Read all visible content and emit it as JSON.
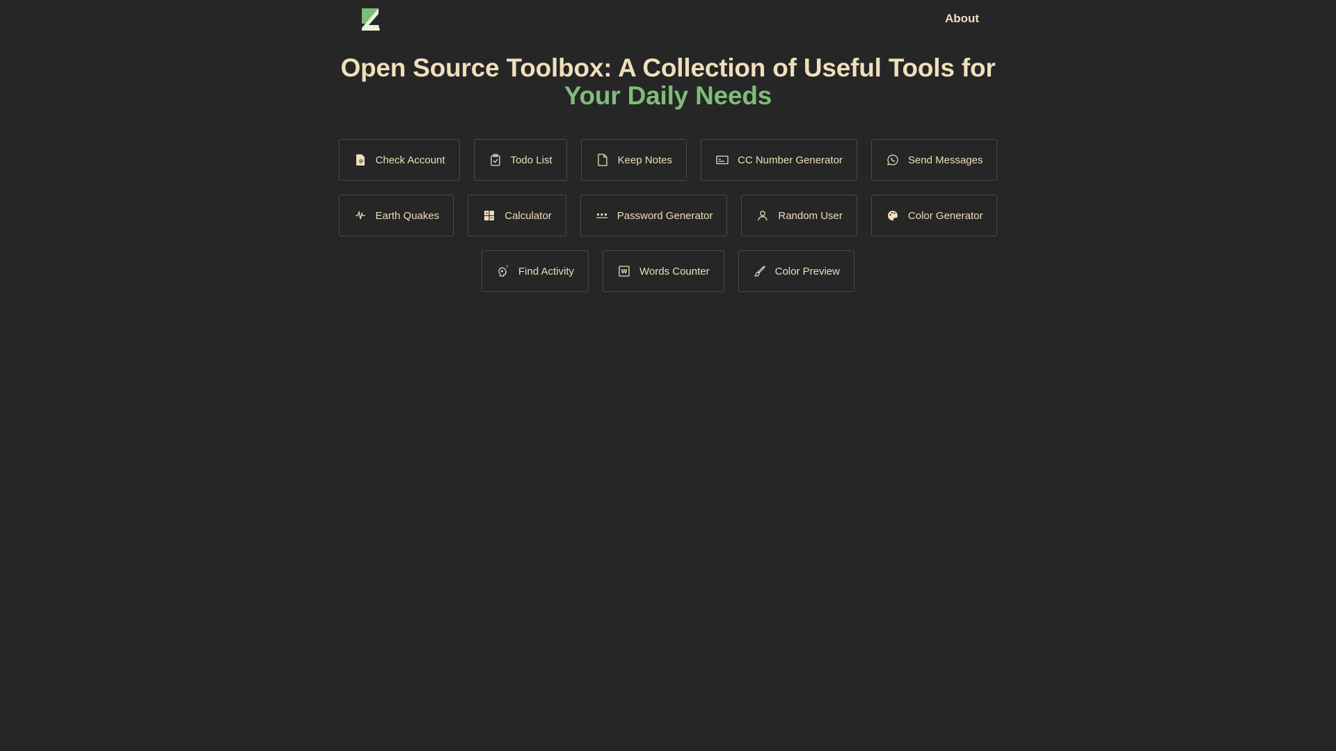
{
  "header": {
    "logo_icon": "z-logo-icon",
    "about_label": "About"
  },
  "hero": {
    "title_main": "Open Source Toolbox: A Collection of Useful Tools for",
    "title_accent": "Your Daily Needs"
  },
  "colors": {
    "background": "#262626",
    "text": "#efdfbb",
    "accent": "#7fbd7a",
    "border": "#4a4a4a"
  },
  "tools": {
    "row1": [
      {
        "label": "Check Account",
        "icon": "account-search-icon"
      },
      {
        "label": "Todo List",
        "icon": "clipboard-check-icon"
      },
      {
        "label": "Keep Notes",
        "icon": "note-icon"
      },
      {
        "label": "CC Number Generator",
        "icon": "credit-card-icon"
      },
      {
        "label": "Send Messages",
        "icon": "whatsapp-icon"
      }
    ],
    "row2": [
      {
        "label": "Earth Quakes",
        "icon": "seismic-icon"
      },
      {
        "label": "Calculator",
        "icon": "calculator-icon"
      },
      {
        "label": "Password Generator",
        "icon": "password-dots-icon"
      },
      {
        "label": "Random User",
        "icon": "user-icon"
      },
      {
        "label": "Color Generator",
        "icon": "palette-icon"
      }
    ],
    "row3": [
      {
        "label": "Find Activity",
        "icon": "thinking-head-icon"
      },
      {
        "label": "Words Counter",
        "icon": "word-frame-icon"
      },
      {
        "label": "Color Preview",
        "icon": "brush-icon"
      }
    ]
  }
}
